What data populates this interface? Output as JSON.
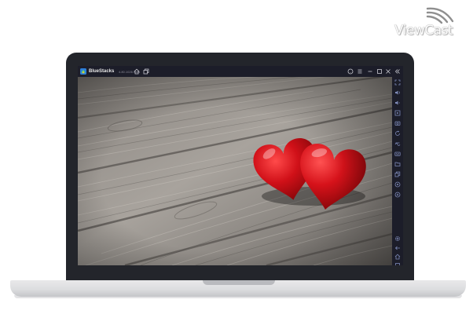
{
  "watermark": {
    "brand": "ViewCast"
  },
  "window": {
    "app_name": "BlueStacks",
    "version": "4.80.1026 Beta",
    "titlebar_icons": [
      "home-icon",
      "multi-instance-icon",
      "help-icon",
      "menu-icon",
      "minimize-icon",
      "maximize-icon",
      "close-icon",
      "collapse-sidebar-icon"
    ]
  },
  "sidebar": {
    "icons": [
      "fullscreen-icon",
      "volume-up-icon",
      "volume-down-icon",
      "screen-record-icon",
      "screenshot-icon",
      "rotate-icon",
      "shake-icon",
      "keymap-icon",
      "folder-icon",
      "copy-icon",
      "camera-icon",
      "location-icon",
      "settings-icon",
      "back-icon",
      "home-icon",
      "recent-apps-icon"
    ]
  },
  "content": {
    "image": "two red hearts on weathered wooden planks"
  },
  "colors": {
    "bezel": "#23252b",
    "titlebar": "#1c1d29",
    "heart": "#c4121a",
    "wood": "#8c8680"
  }
}
